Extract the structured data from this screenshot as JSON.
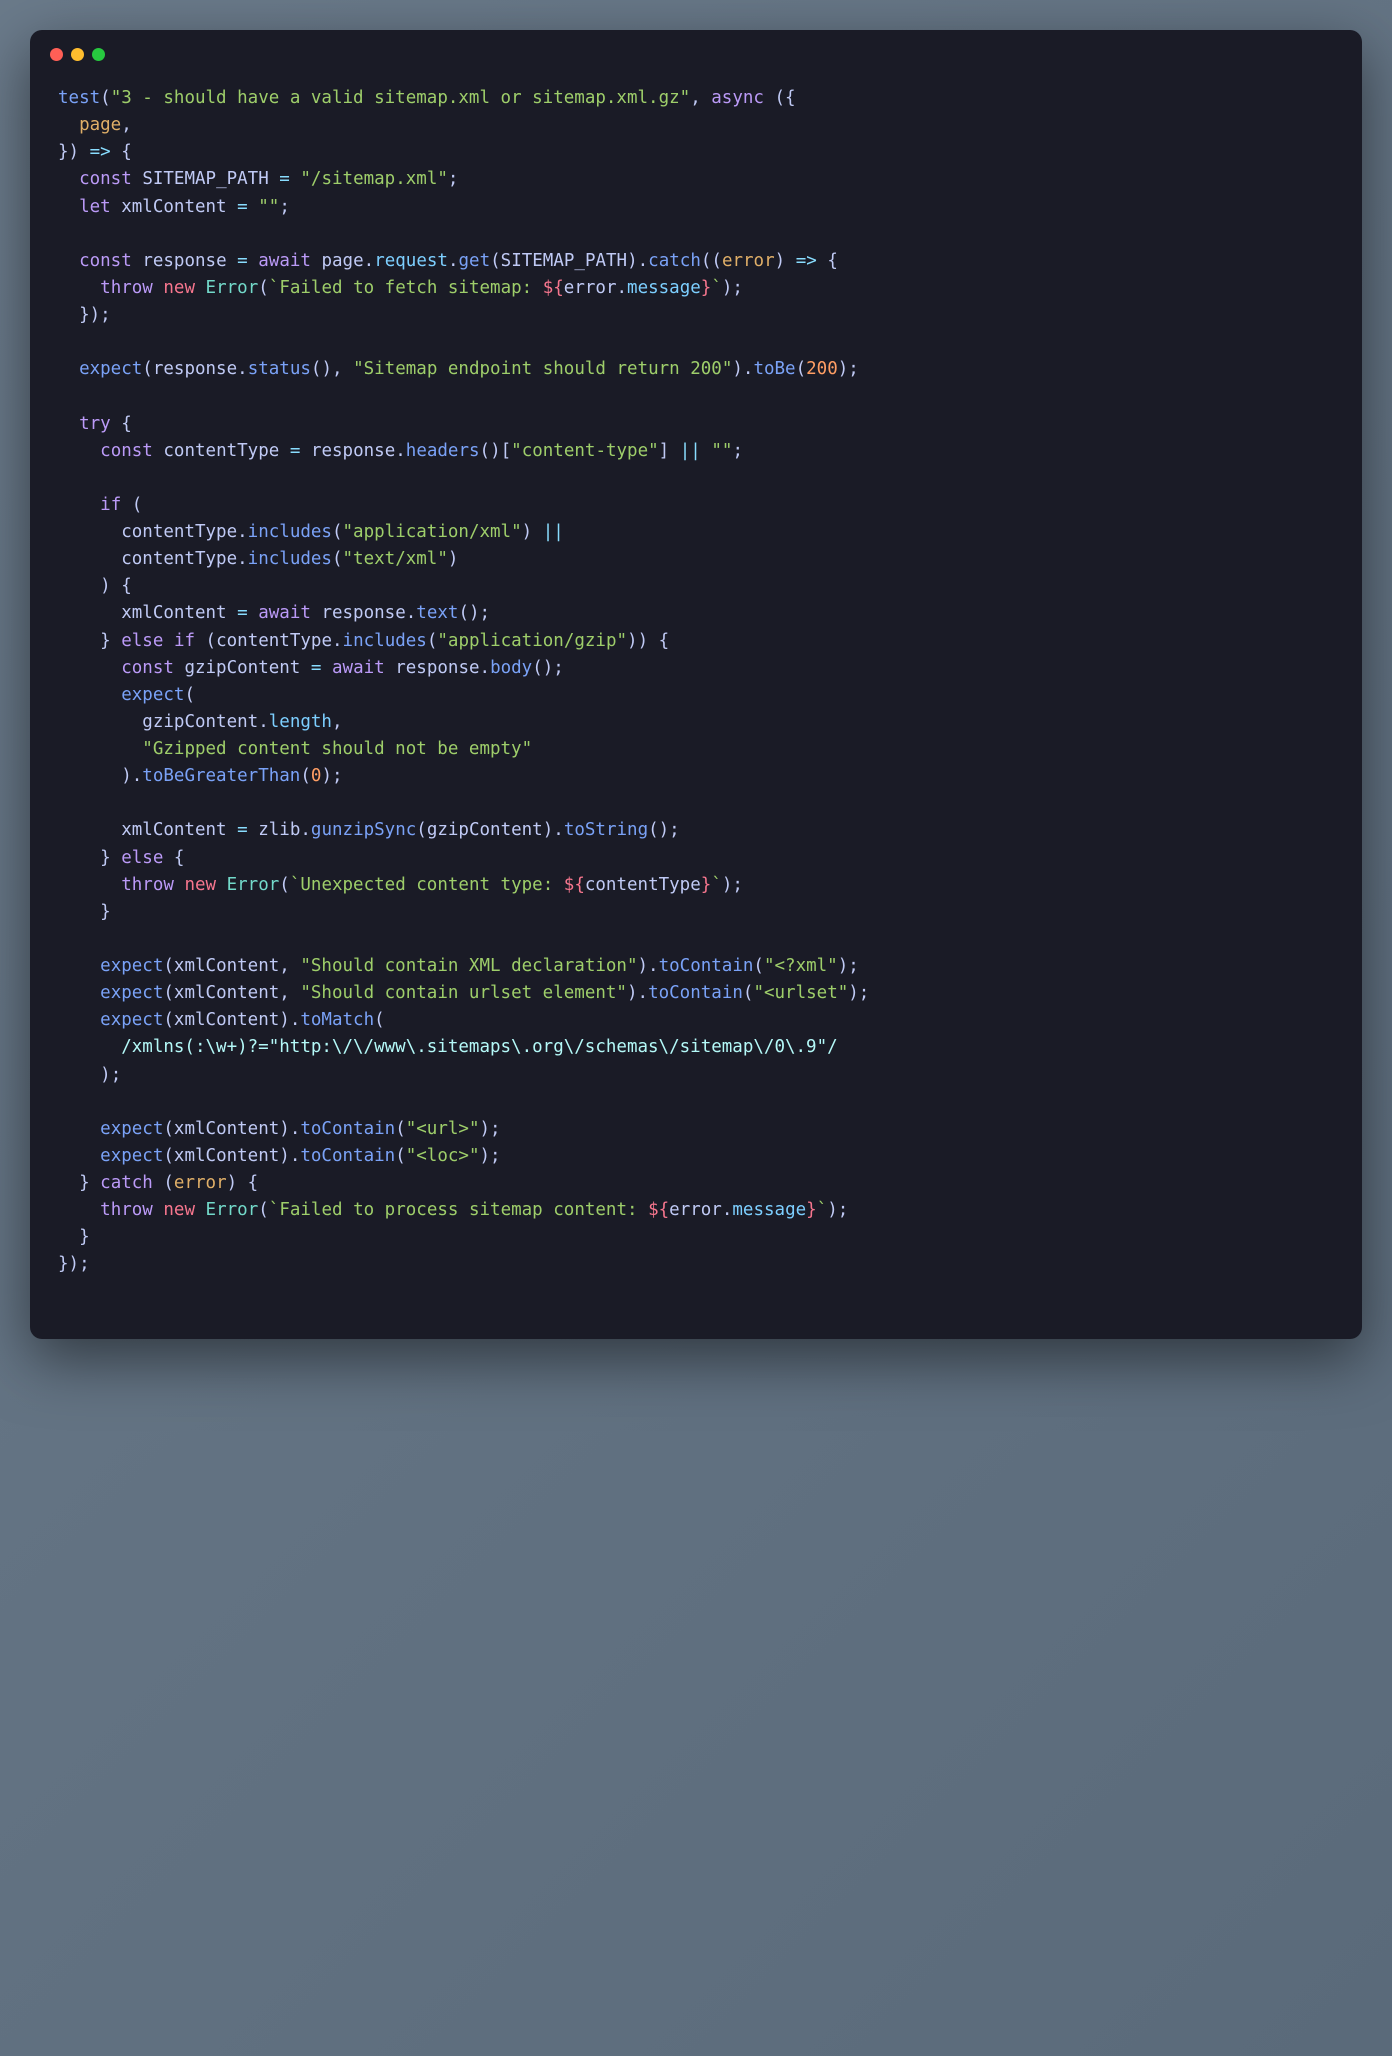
{
  "window": {
    "buttons": [
      "close",
      "minimize",
      "maximize"
    ]
  },
  "code": {
    "t": {
      "test": "test",
      "async": "async",
      "const": "const",
      "let": "let",
      "await": "await",
      "throw": "throw",
      "new": "new",
      "try": "try",
      "catch": "catch",
      "if": "if",
      "else": "else",
      "Error": "Error",
      "arrow": "=>",
      "or": "||",
      "eq": "="
    },
    "s": {
      "testDesc": "\"3 - should have a valid sitemap.xml or sitemap.xml.gz\"",
      "sitemapPath": "\"/sitemap.xml\"",
      "empty": "\"\"",
      "fetchFail1": "`Failed to fetch sitemap: ",
      "tplEnd": "`",
      "sitemapMsg": "\"Sitemap endpoint should return 200\"",
      "contentTypeKey": "\"content-type\"",
      "appXml": "\"application/xml\"",
      "textXml": "\"text/xml\"",
      "appGzip": "\"application/gzip\"",
      "gzipMsg": "\"Gzipped content should not be empty\"",
      "unexpected1": "`Unexpected content type: ",
      "xmlDeclMsg": "\"Should contain XML declaration\"",
      "xmlDecl": "\"<?xml\"",
      "urlsetMsg": "\"Should contain urlset element\"",
      "urlset": "\"<urlset\"",
      "urlTag": "\"<url>\"",
      "locTag": "\"<loc>\"",
      "procFail1": "`Failed to process sitemap content: "
    },
    "v": {
      "page": "page",
      "SITEMAP_PATH": "SITEMAP_PATH",
      "xmlContent": "xmlContent",
      "response": "response",
      "error": "error",
      "contentType": "contentType",
      "gzipContent": "gzipContent",
      "zlib": "zlib"
    },
    "p": {
      "request": "request",
      "get": "get",
      "catch": "catch",
      "message": "message",
      "status": "status",
      "toBe": "toBe",
      "headers": "headers",
      "includes": "includes",
      "text": "text",
      "body": "body",
      "length": "length",
      "toBeGreaterThan": "toBeGreaterThan",
      "gunzipSync": "gunzipSync",
      "toString": "toString",
      "toContain": "toContain",
      "toMatch": "toMatch"
    },
    "fn": {
      "expect": "expect"
    },
    "n": {
      "n200": "200",
      "n0": "0"
    },
    "regex": "/xmlns(:\\w+)?=\"http:\\/\\/www\\.sitemaps\\.org\\/schemas\\/sitemap\\/0\\.9\"/"
  }
}
